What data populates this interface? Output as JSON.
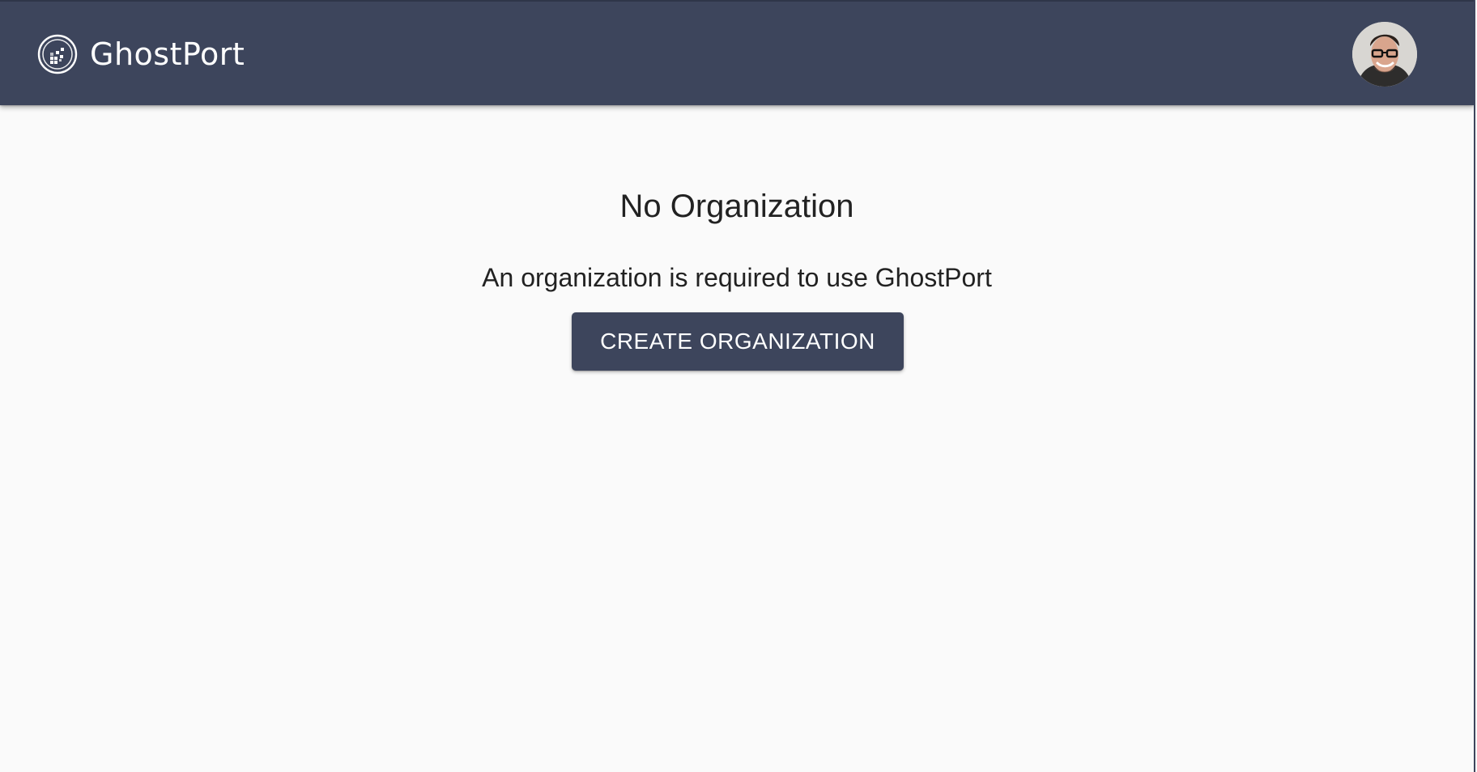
{
  "header": {
    "app_name": "GhostPort",
    "logo_icon": "ghostport-logo-icon",
    "avatar_icon": "user-avatar"
  },
  "main": {
    "title": "No Organization",
    "message": "An organization is required to use GhostPort",
    "create_button_label": "CREATE ORGANIZATION"
  },
  "colors": {
    "header_background": "#3d455c",
    "button_background": "#3d455c",
    "page_background": "#fafafa",
    "text": "#222222"
  }
}
